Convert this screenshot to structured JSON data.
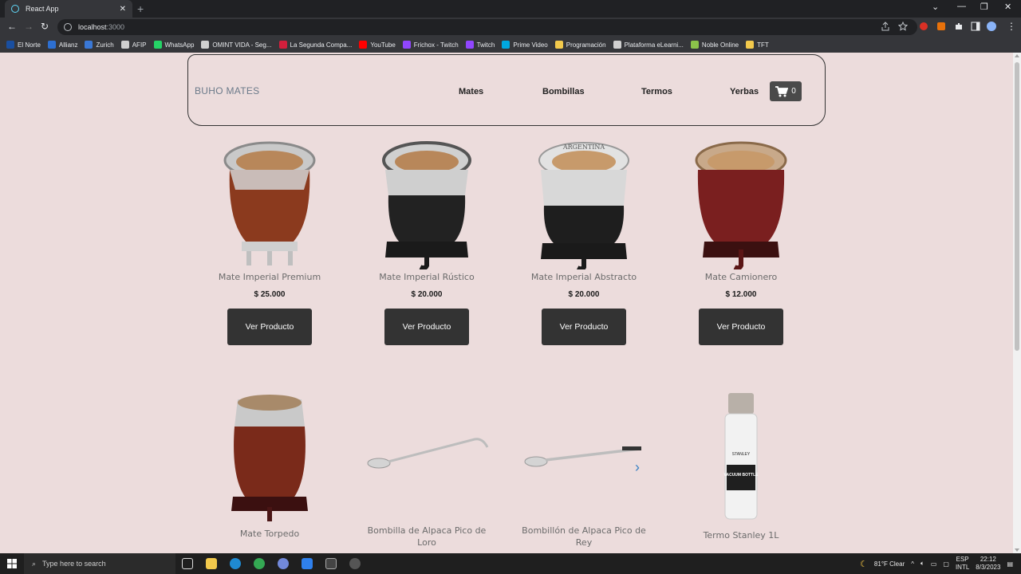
{
  "browser": {
    "tab_title": "React App",
    "url_host": "localhost",
    "url_port": ":3000",
    "bookmarks": [
      {
        "label": "El Norte",
        "color": "#1a4fa0"
      },
      {
        "label": "Allianz",
        "color": "#2d6fd1"
      },
      {
        "label": "Zurich",
        "color": "#3a78d6"
      },
      {
        "label": "AFIP",
        "color": "#cfcfcf"
      },
      {
        "label": "WhatsApp",
        "color": "#25d366"
      },
      {
        "label": "OMINT VIDA - Seg...",
        "color": "#d0d0d0"
      },
      {
        "label": "La Segunda Compa...",
        "color": "#d21f3c"
      },
      {
        "label": "YouTube",
        "color": "#ff0000"
      },
      {
        "label": "Frichox - Twitch",
        "color": "#9146ff"
      },
      {
        "label": "Twitch",
        "color": "#9146ff"
      },
      {
        "label": "Prime Video",
        "color": "#00a8e1"
      },
      {
        "label": "Programación",
        "color": "#f2c94c"
      },
      {
        "label": "Plataforma eLearni...",
        "color": "#d0d0d0"
      },
      {
        "label": "Noble Online",
        "color": "#8bc34a"
      },
      {
        "label": "TFT",
        "color": "#f2c94c"
      }
    ]
  },
  "navbar": {
    "brand": "BUHO MATES",
    "links": [
      "Mates",
      "Bombillas",
      "Termos",
      "Yerbas"
    ],
    "cart_count": "0"
  },
  "products": [
    {
      "name": "Mate Imperial Premium",
      "price": "$ 25.000",
      "button": "Ver Producto"
    },
    {
      "name": "Mate Imperial Rústico",
      "price": "$ 20.000",
      "button": "Ver Producto"
    },
    {
      "name": "Mate Imperial Abstracto",
      "price": "$ 20.000",
      "button": "Ver Producto"
    },
    {
      "name": "Mate Camionero",
      "price": "$ 12.000",
      "button": "Ver Producto"
    },
    {
      "name": "Mate Torpedo"
    },
    {
      "name": "Bombilla de Alpaca Pico de Loro"
    },
    {
      "name": "Bombillón de Alpaca Pico de Rey"
    },
    {
      "name": "Termo Stanley 1L"
    }
  ],
  "product_images": {
    "mate3_band_text": "ARGENTINA",
    "stanley_logo_text": "STANLEY",
    "stanley_label_text": "VACUUM BOTTLE"
  },
  "taskbar": {
    "search_placeholder": "Type here to search",
    "weather": "81°F  Clear",
    "lang_top": "ESP",
    "lang_bottom": "INTL",
    "time": "22:12",
    "date": "8/3/2023"
  },
  "colors": {
    "page_bg": "#ecdcdc",
    "button_bg": "#333333",
    "cart_bg": "#4a4a4a"
  }
}
